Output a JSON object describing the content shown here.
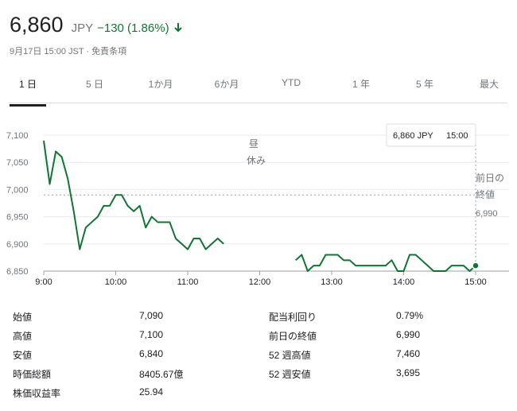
{
  "quote": {
    "price": "6,860",
    "currency": "JPY",
    "change": "−130 (1.86%)",
    "timestamp": "9月17日 15:00 JST · 免責条項"
  },
  "tabs": [
    {
      "label": "1 日",
      "active": true
    },
    {
      "label": "5 日",
      "active": false
    },
    {
      "label": "1か月",
      "active": false
    },
    {
      "label": "6か月",
      "active": false
    },
    {
      "label": "YTD",
      "active": false
    },
    {
      "label": "1 年",
      "active": false
    },
    {
      "label": "5 年",
      "active": false
    },
    {
      "label": "最大",
      "active": false
    }
  ],
  "chart_data": {
    "type": "line",
    "x_ticks": [
      "9:00",
      "10:00",
      "11:00",
      "12:00",
      "13:00",
      "14:00",
      "15:00"
    ],
    "y_ticks": [
      6850,
      6900,
      6950,
      7000,
      7050,
      7100
    ],
    "y_tick_labels": [
      "6,850",
      "6,900",
      "6,950",
      "7,000",
      "7,050",
      "7,100"
    ],
    "ylim": [
      6850,
      7100
    ],
    "series": [
      {
        "morning": {
          "x": [
            "9:00",
            "9:05",
            "9:10",
            "9:15",
            "9:20",
            "9:25",
            "9:30",
            "9:35",
            "9:40",
            "9:45",
            "9:50",
            "9:55",
            "10:00",
            "10:05",
            "10:10",
            "10:15",
            "10:20",
            "10:25",
            "10:30",
            "10:35",
            "10:40",
            "10:45",
            "10:50",
            "10:55",
            "11:00",
            "11:05",
            "11:10",
            "11:15",
            "11:20",
            "11:25",
            "11:30"
          ],
          "y": [
            7090,
            7010,
            7070,
            7060,
            7020,
            6960,
            6890,
            6930,
            6940,
            6950,
            6970,
            6970,
            6990,
            6990,
            6970,
            6960,
            6970,
            6930,
            6950,
            6940,
            6940,
            6940,
            6910,
            6900,
            6890,
            6910,
            6910,
            6890,
            6900,
            6910,
            6900
          ]
        },
        "afternoon": {
          "x": [
            "12:30",
            "12:35",
            "12:40",
            "12:45",
            "12:50",
            "12:55",
            "13:00",
            "13:05",
            "13:10",
            "13:15",
            "13:20",
            "13:25",
            "13:30",
            "13:35",
            "13:40",
            "13:45",
            "13:50",
            "13:55",
            "14:00",
            "14:05",
            "14:10",
            "14:15",
            "14:20",
            "14:25",
            "14:30",
            "14:35",
            "14:40",
            "14:45",
            "14:50",
            "14:55",
            "15:00"
          ],
          "y": [
            6870,
            6880,
            6850,
            6860,
            6860,
            6880,
            6880,
            6880,
            6870,
            6870,
            6860,
            6860,
            6860,
            6860,
            6860,
            6860,
            6870,
            6850,
            6850,
            6880,
            6880,
            6870,
            6860,
            6850,
            6850,
            6850,
            6860,
            6860,
            6860,
            6850,
            6860
          ]
        }
      }
    ],
    "prev_close": 6990,
    "prev_close_label_1": "前日の",
    "prev_close_label_2": "終値",
    "prev_close_value": "6,990",
    "lunch_label_1": "昼",
    "lunch_label_2": "休み",
    "tooltip_price": "6,860 JPY",
    "tooltip_time": "15:00",
    "colors": {
      "line": "#137333",
      "fill": "#e6f4ea",
      "grid": "#e8eaed",
      "dotted": "#9aa0a6"
    }
  },
  "stats": {
    "left": [
      {
        "label": "始値",
        "value": "7,090"
      },
      {
        "label": "高値",
        "value": "7,100"
      },
      {
        "label": "安値",
        "value": "6,840"
      },
      {
        "label": "時価総額",
        "value": "8405.67億"
      },
      {
        "label": "株価収益率",
        "value": "25.94"
      }
    ],
    "right": [
      {
        "label": "配当利回り",
        "value": "0.79%"
      },
      {
        "label": "前日の終値",
        "value": "6,990"
      },
      {
        "label": "52 週高値",
        "value": "7,460"
      },
      {
        "label": "52 週安値",
        "value": "3,695"
      }
    ]
  }
}
